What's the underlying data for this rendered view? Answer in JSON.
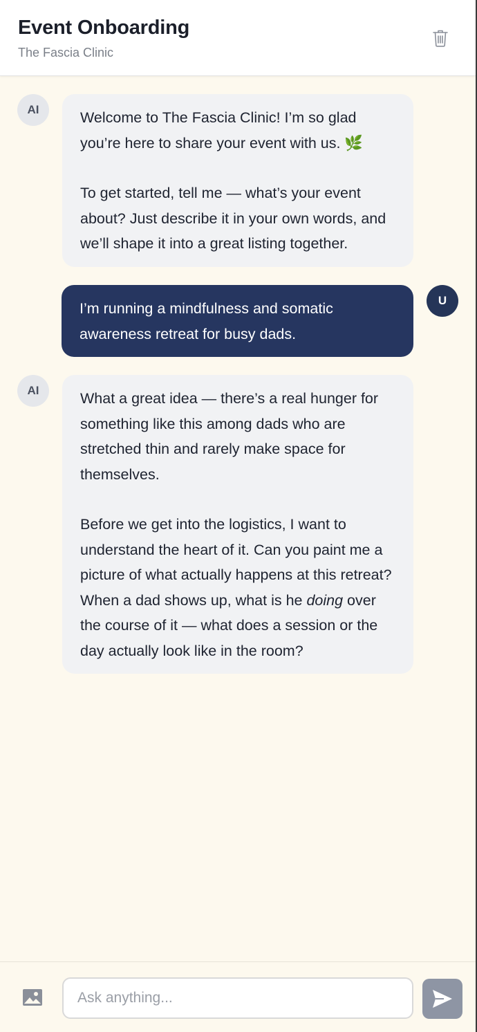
{
  "header": {
    "title": "Event Onboarding",
    "subtitle": "The Fascia Clinic",
    "trash_icon": "trash-icon"
  },
  "messages": [
    {
      "role": "ai",
      "avatar": "AI",
      "paragraphs": [
        "Welcome to The Fascia Clinic! I’m so glad you’re here to share your event with us. 🌿",
        "To get started, tell me — what’s your event about? Just describe it in your own words, and we’ll shape it into a great listing together."
      ]
    },
    {
      "role": "user",
      "avatar": "U",
      "text": "I’m running a mindfulness and somatic awareness retreat for busy dads."
    },
    {
      "role": "ai",
      "avatar": "AI",
      "paragraph1": "What a great idea — there’s a real hunger for something like this among dads who are stretched thin and rarely make space for themselves.",
      "paragraph2_before": "Before we get into the logistics, I want to understand the heart of it. Can you paint me a picture of what actually happens at this retreat? When a dad shows up, what is he ",
      "paragraph2_emphasis": "doing",
      "paragraph2_after": " over the course of it — what does a session or the day actually look like in the room?"
    }
  ],
  "composer": {
    "placeholder": "Ask anything...",
    "value": "",
    "image_icon": "image-icon",
    "send_icon": "send-icon"
  },
  "colors": {
    "background": "#fdf9ee",
    "user_bubble": "#263660",
    "ai_bubble": "#f1f2f4",
    "send_button": "#8e95a4"
  }
}
